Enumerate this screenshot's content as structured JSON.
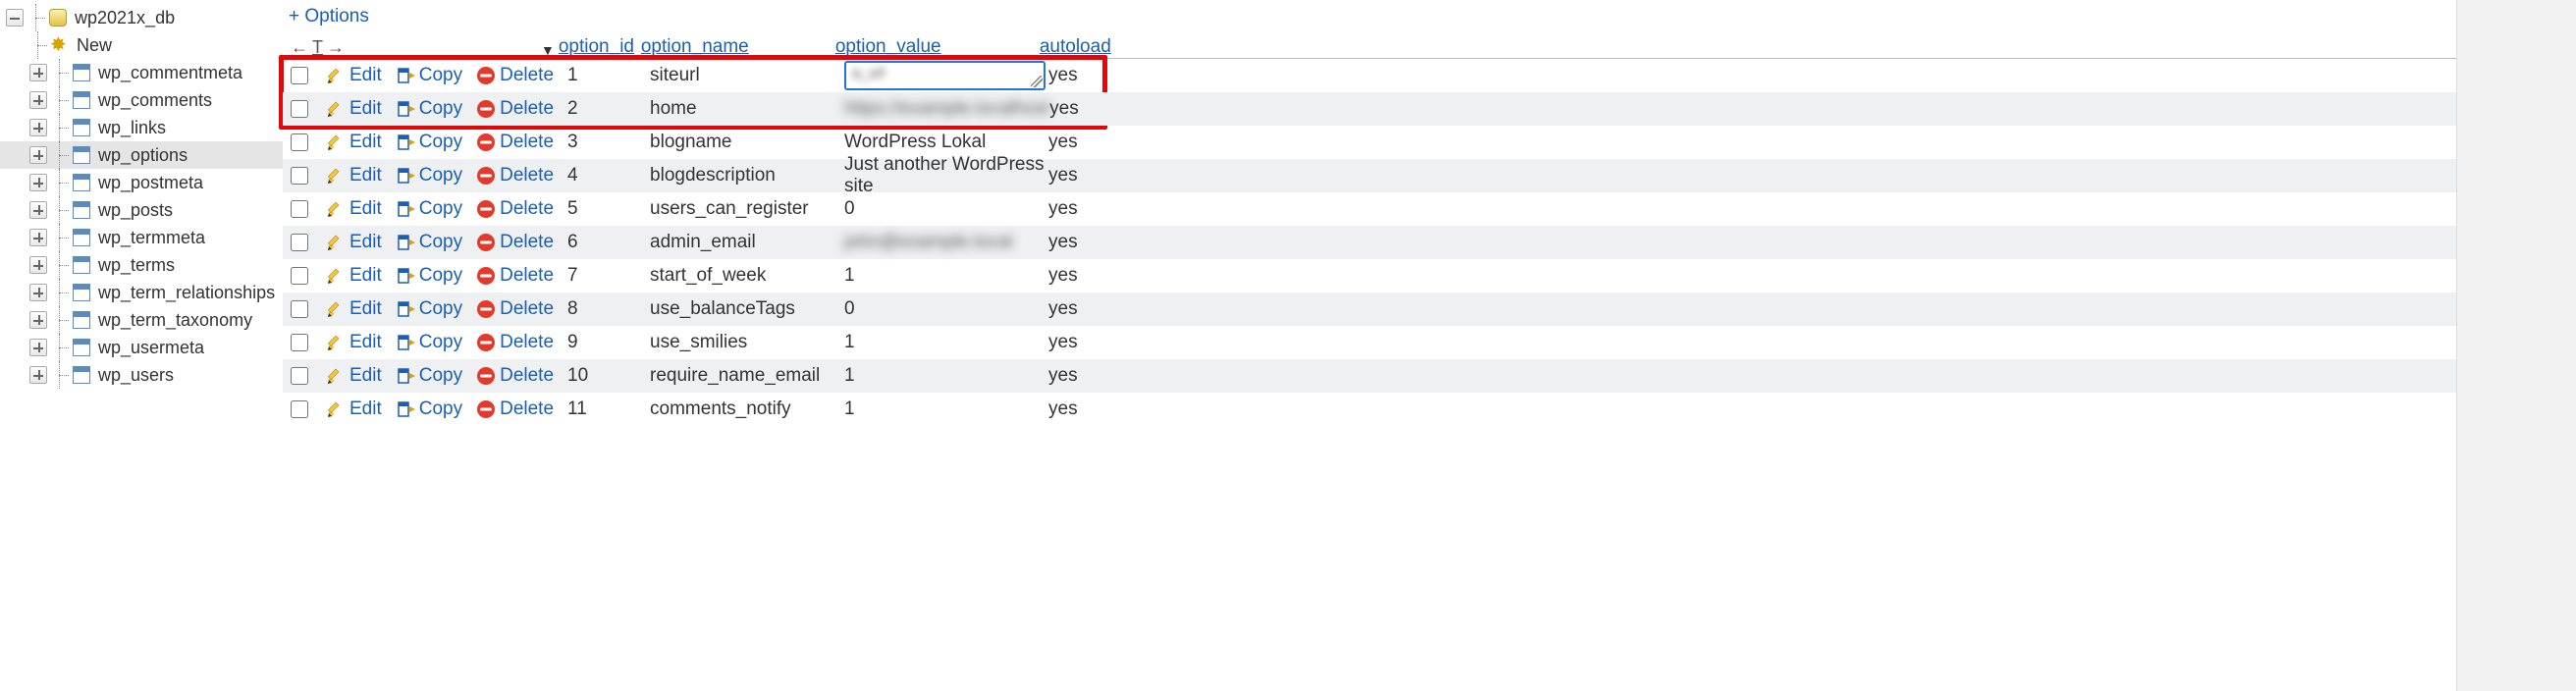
{
  "sidebar": {
    "db_name": "wp2021x_db",
    "new_label": "New",
    "tables": [
      "wp_commentmeta",
      "wp_comments",
      "wp_links",
      "wp_options",
      "wp_postmeta",
      "wp_posts",
      "wp_termmeta",
      "wp_terms",
      "wp_term_relationships",
      "wp_term_taxonomy",
      "wp_usermeta",
      "wp_users"
    ],
    "selected_index": 3
  },
  "toolbar": {
    "options_link": "+ Options",
    "arrow_left": "←",
    "arrow_t": "T",
    "arrow_right": "→",
    "sort_glyph": "▼"
  },
  "columns": {
    "option_id": "option_id",
    "option_name": "option_name",
    "option_value": "option_value",
    "autoload": "autoload"
  },
  "action_labels": {
    "edit": "Edit",
    "copy": "Copy",
    "delete": "Delete"
  },
  "rows": [
    {
      "id": "1",
      "name": "siteurl",
      "value": "",
      "value_blur": true,
      "autoload": "yes",
      "inline_edit": true,
      "edit_text": "a_url"
    },
    {
      "id": "2",
      "name": "home",
      "value": "https://example.localhost",
      "value_blur": true,
      "autoload": "yes"
    },
    {
      "id": "3",
      "name": "blogname",
      "value": "WordPress Lokal",
      "value_blur": false,
      "autoload": "yes"
    },
    {
      "id": "4",
      "name": "blogdescription",
      "value": "Just another WordPress site",
      "value_blur": false,
      "autoload": "yes"
    },
    {
      "id": "5",
      "name": "users_can_register",
      "value": "0",
      "value_blur": false,
      "autoload": "yes"
    },
    {
      "id": "6",
      "name": "admin_email",
      "value": "john@example.local",
      "value_blur": true,
      "autoload": "yes"
    },
    {
      "id": "7",
      "name": "start_of_week",
      "value": "1",
      "value_blur": false,
      "autoload": "yes"
    },
    {
      "id": "8",
      "name": "use_balanceTags",
      "value": "0",
      "value_blur": false,
      "autoload": "yes"
    },
    {
      "id": "9",
      "name": "use_smilies",
      "value": "1",
      "value_blur": false,
      "autoload": "yes"
    },
    {
      "id": "10",
      "name": "require_name_email",
      "value": "1",
      "value_blur": false,
      "autoload": "yes"
    },
    {
      "id": "11",
      "name": "comments_notify",
      "value": "1",
      "value_blur": false,
      "autoload": "yes"
    }
  ],
  "highlight": {
    "row_indices": [
      0,
      1
    ]
  }
}
